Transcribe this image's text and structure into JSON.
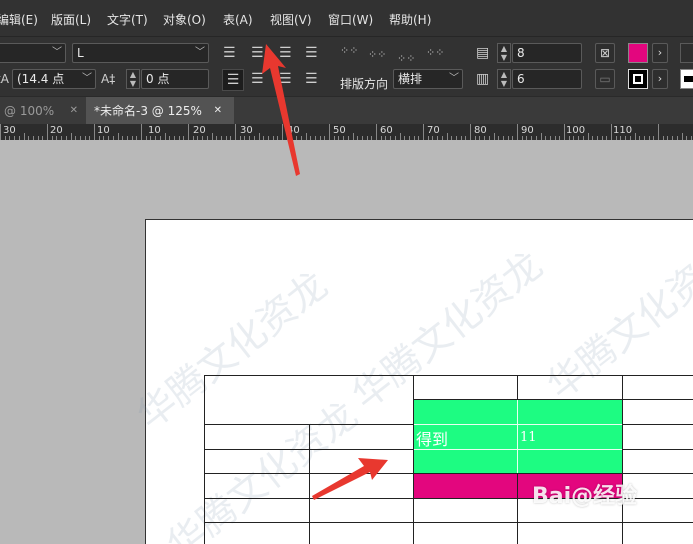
{
  "menu": {
    "items": [
      "编辑(E)",
      "版面(L)",
      "文字(T)",
      "对象(O)",
      "表(A)",
      "视图(V)",
      "窗口(W)",
      "帮助(H)"
    ]
  },
  "control": {
    "font_style": "L",
    "leading": "(14.4 点",
    "tracking": "0 点",
    "text_direction_label": "排版方向",
    "text_direction_value": "横排",
    "rows": "8",
    "columns": "6"
  },
  "tabs": [
    {
      "label": "@ 100%",
      "close": "✕"
    },
    {
      "label": "*未命名-3 @ 125%",
      "close": "✕"
    }
  ],
  "ruler": {
    "labels": [
      "30",
      "20",
      "10",
      "10",
      "20",
      "30",
      "40",
      "50",
      "60",
      "70",
      "80",
      "90",
      "100",
      "110"
    ]
  },
  "table": {
    "cell1": "得到",
    "cell2": "11"
  },
  "colors": {
    "green": "#1dfc82",
    "magenta": "#e3067e",
    "arrow": "#e8382f",
    "ui_bg": "#323232",
    "canvas": "#b9b9b9"
  },
  "watermark": {
    "text": "华腾文化资龙",
    "brand": "Bai@经验"
  }
}
